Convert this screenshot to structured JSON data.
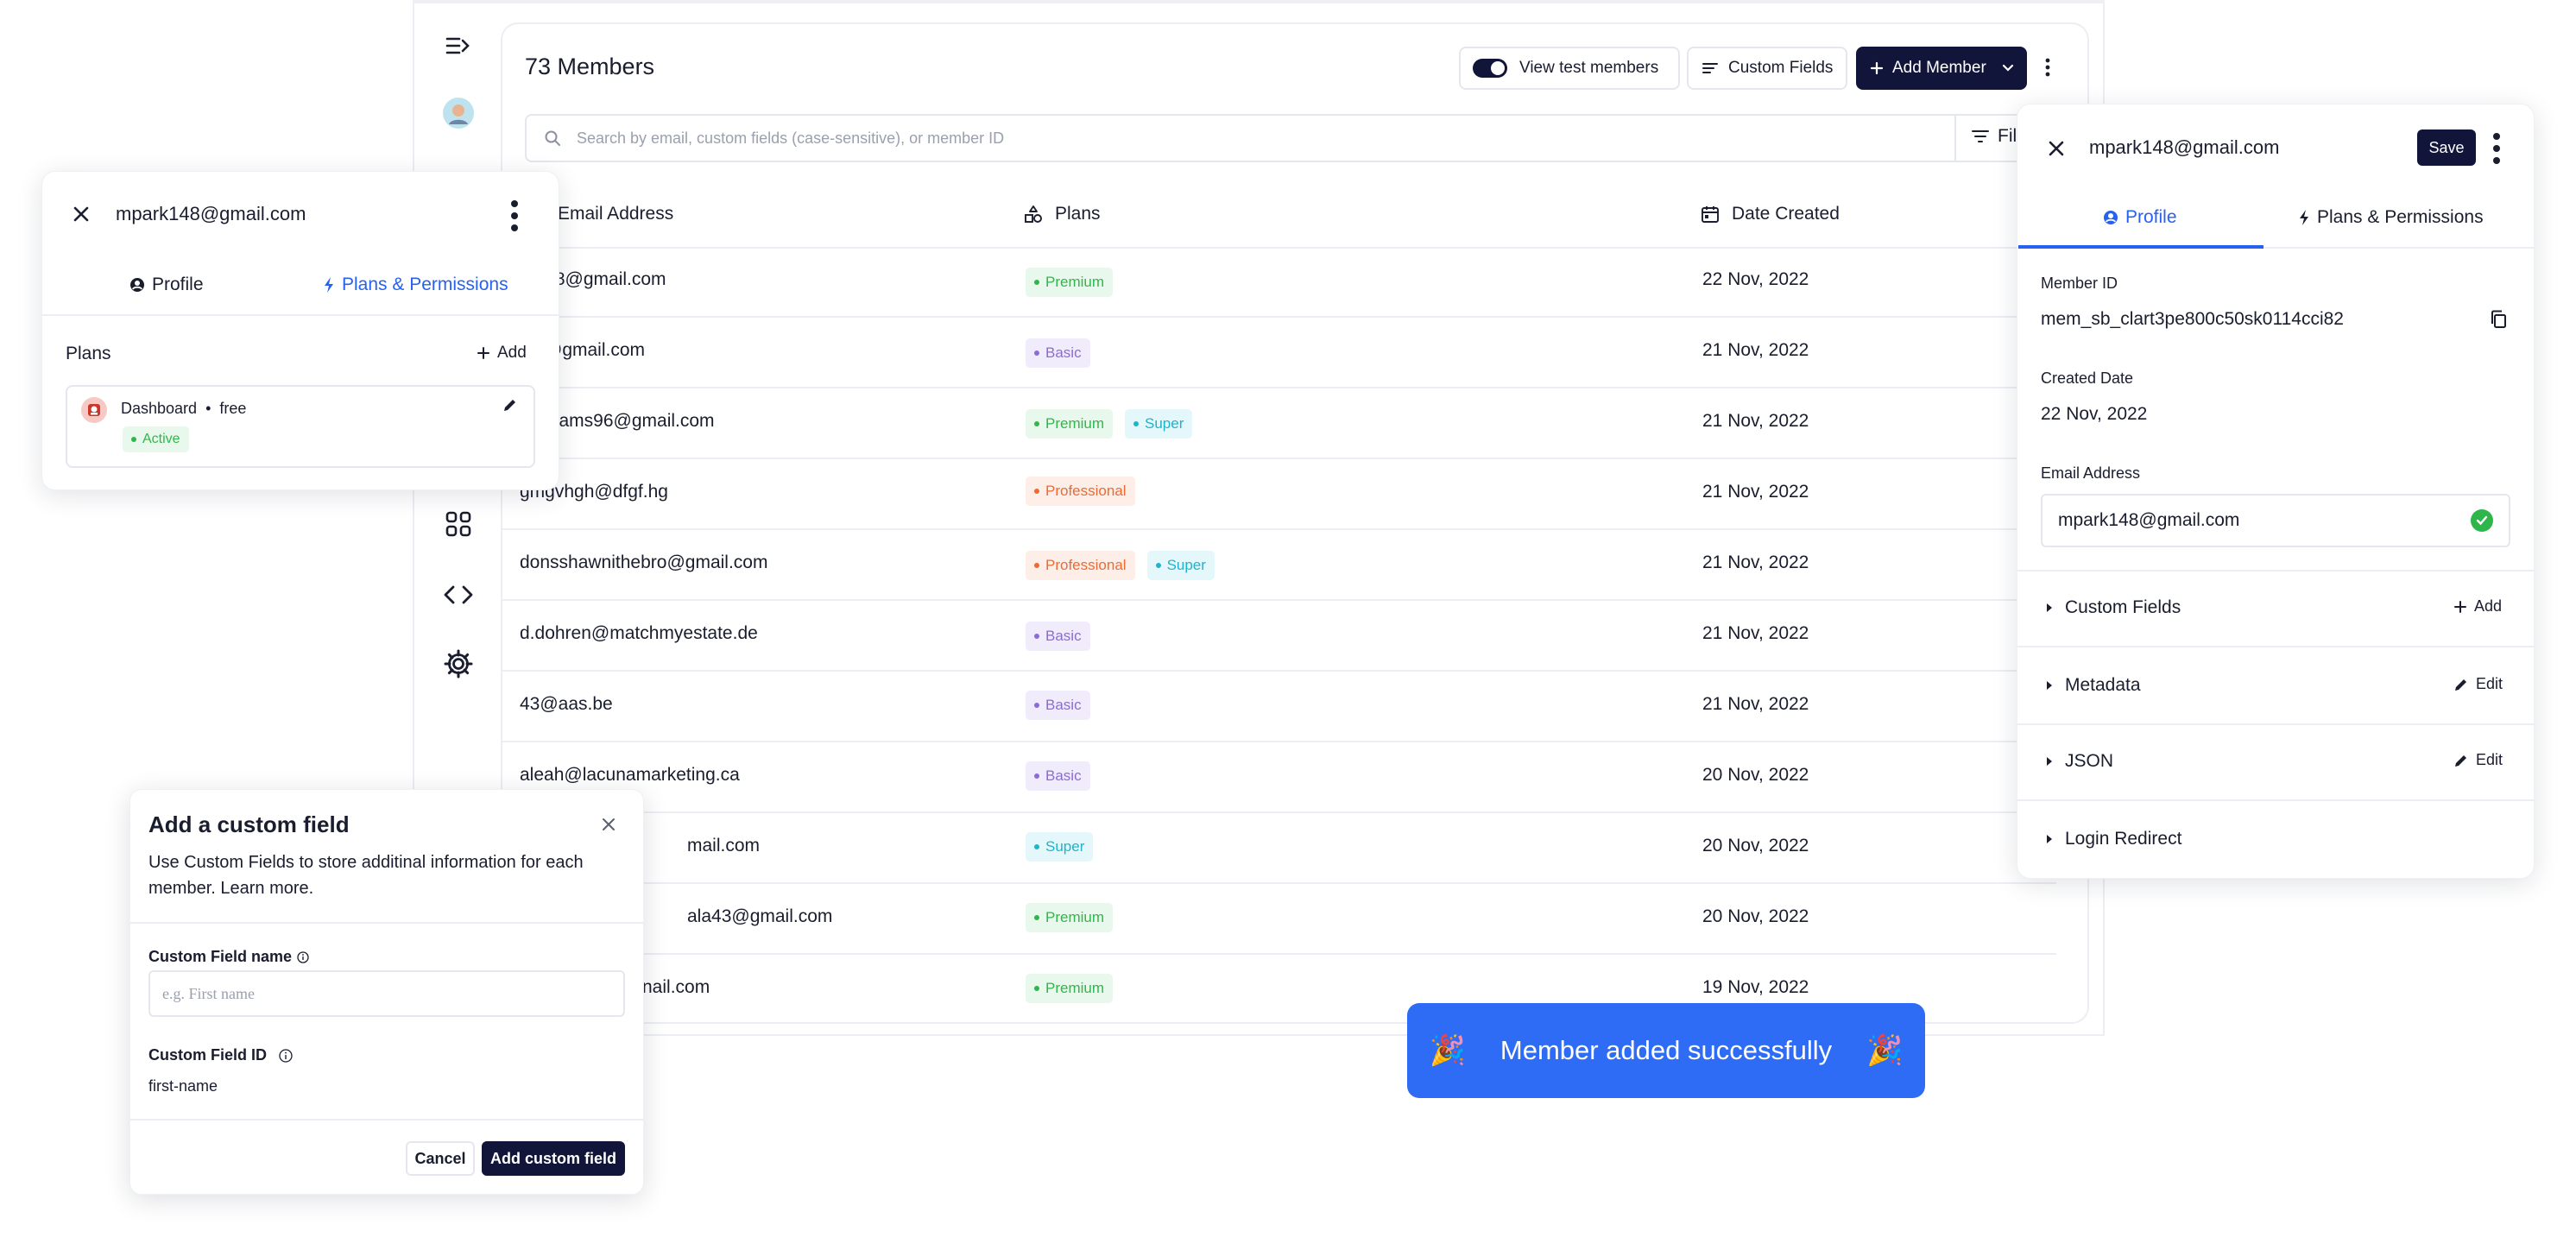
{
  "header": {
    "members_title": "73 Members",
    "toggle_label": "View test members",
    "custom_fields_label": "Custom Fields",
    "add_member_label": "Add Member"
  },
  "search": {
    "placeholder": "Search by email, custom fields (case-sensitive), or member ID",
    "filter_label": "Fil"
  },
  "table": {
    "columns": [
      "Email Address",
      "Plans",
      "Date Created"
    ],
    "rows": [
      {
        "email": "rk148@gmail.com",
        "date": "22 Nov, 2022"
      },
      {
        "email": "sto@gmail.com",
        "date": "21 Nov, 2022"
      },
      {
        "email": "nwilliams96@gmail.com",
        "date": "21 Nov, 2022"
      },
      {
        "email": "gmgvhgh@dfgf.hg",
        "date": "21 Nov, 2022"
      },
      {
        "email": "donsshawnithebro@gmail.com",
        "date": "21 Nov, 2022"
      },
      {
        "email": "d.dohren@matchmyestate.de",
        "date": "21 Nov, 2022"
      },
      {
        "email": "43@aas.be",
        "date": "21 Nov, 2022"
      },
      {
        "email": "aleah@lacunamarketing.ca",
        "date": "20 Nov, 2022"
      },
      {
        "email": "mail.com",
        "date": "20 Nov, 2022"
      },
      {
        "email": "ala43@gmail.com",
        "date": "20 Nov, 2022"
      },
      {
        "email": "nail.com",
        "date": "19 Nov, 2022"
      }
    ],
    "plan_tags": {
      "premium": "Premium",
      "basic": "Basic",
      "super": "Super",
      "professional": "Professional"
    }
  },
  "plan_colors": {
    "premium_bg": "#e9f8ec",
    "premium_fg": "#31b64a",
    "basic_bg": "#f1ecfb",
    "basic_fg": "#8c6ad8",
    "super_bg": "#e4f8fb",
    "super_fg": "#1fb3cc",
    "professional_bg": "#fdeee7",
    "professional_fg": "#ef6a33"
  },
  "left_panel": {
    "email": "mpark148@gmail.com",
    "tab_profile": "Profile",
    "tab_plans": "Plans & Permissions",
    "plans_label": "Plans",
    "add_label": "Add",
    "plan_name": "Dashboard",
    "plan_sep": "•",
    "plan_price": "free",
    "plan_status": "Active"
  },
  "right_panel": {
    "email": "mpark148@gmail.com",
    "save_label": "Save",
    "tab_profile": "Profile",
    "tab_plans": "Plans & Permissions",
    "member_id_label": "Member ID",
    "member_id": "mem_sb_clart3pe800c50sk0114cci82",
    "created_label": "Created Date",
    "created_date": "22 Nov, 2022",
    "email_label": "Email Address",
    "email_value": "mpark148@gmail.com",
    "sections": {
      "custom_fields": "Custom Fields",
      "metadata": "Metadata",
      "json": "JSON",
      "login_redirect": "Login Redirect"
    },
    "add_label": "Add",
    "edit_label": "Edit"
  },
  "custom_field_modal": {
    "title": "Add a custom field",
    "description": "Use Custom Fields to store additinal information for each member. Learn more.",
    "name_label": "Custom Field name",
    "name_placeholder": "e.g. First name",
    "id_label": "Custom Field ID",
    "id_value": "first-name",
    "cancel_label": "Cancel",
    "submit_label": "Add custom field"
  },
  "toast": {
    "message": "Member added successfully",
    "emoji": "🎉"
  },
  "accent": {
    "brand_dark": "#12153a",
    "link_blue": "#2761f0",
    "toast_blue": "#2e6cf6",
    "success_green": "#2fb64a"
  },
  "icons": {
    "sidebar": [
      "collapse-menu-icon",
      "avatar-icon",
      "apps-grid-icon",
      "code-icon",
      "settings-gear-icon"
    ]
  }
}
